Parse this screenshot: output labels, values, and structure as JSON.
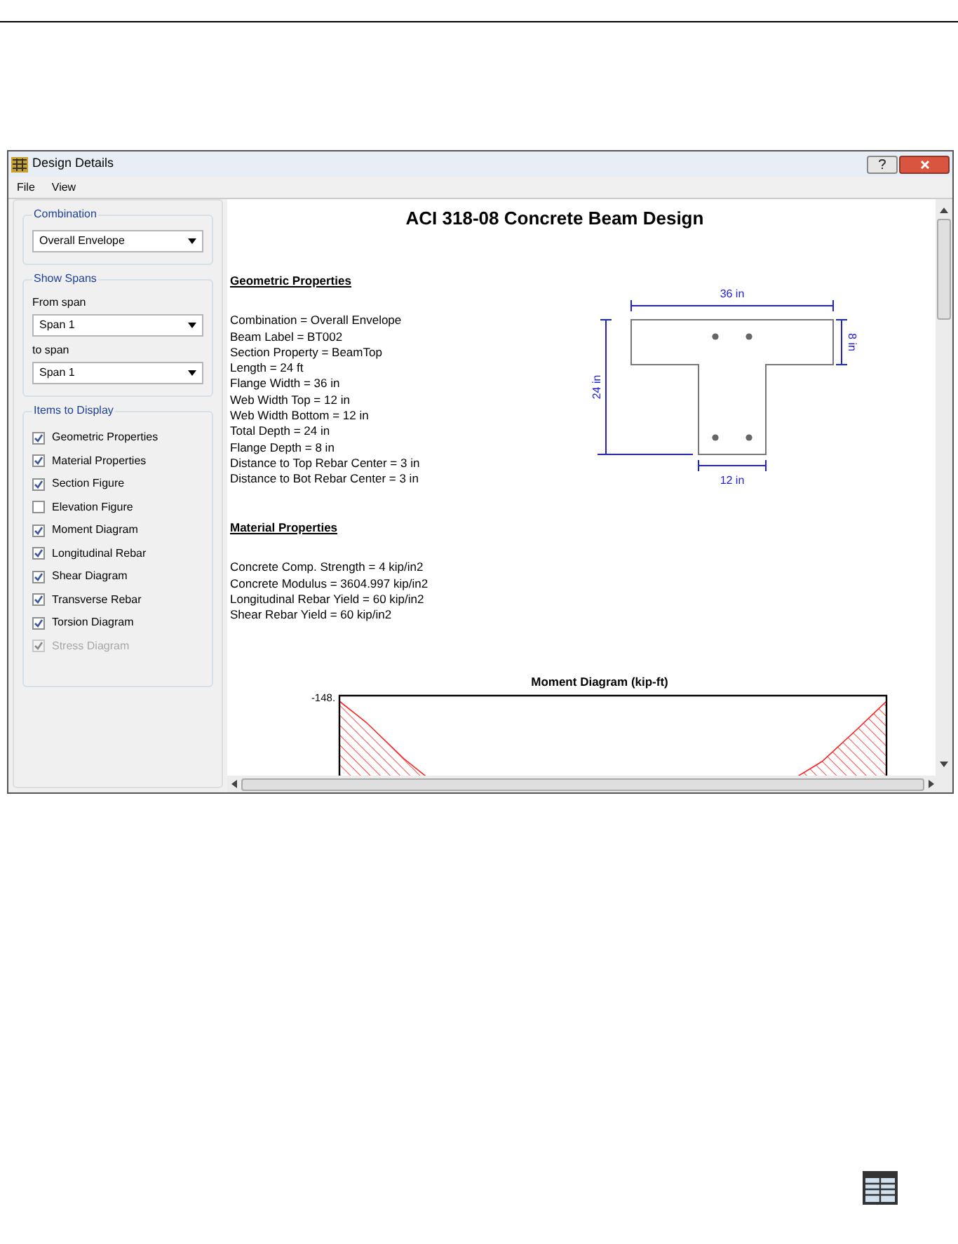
{
  "window": {
    "title": "Design Details"
  },
  "menu": [
    "File",
    "View"
  ],
  "combination": {
    "label": "Combination",
    "value": "Overall Envelope"
  },
  "show_spans": {
    "label": "Show Spans",
    "from_label": "From span",
    "from_value": "Span 1",
    "to_label": "to span",
    "to_value": "Span 1"
  },
  "items_to_display": {
    "label": "Items to Display",
    "items": [
      {
        "label": "Geometric Properties",
        "checked": true,
        "disabled": false
      },
      {
        "label": "Material Properties",
        "checked": true,
        "disabled": false
      },
      {
        "label": "Section Figure",
        "checked": true,
        "disabled": false
      },
      {
        "label": "Elevation Figure",
        "checked": false,
        "disabled": false
      },
      {
        "label": "Moment Diagram",
        "checked": true,
        "disabled": false
      },
      {
        "label": "Longitudinal Rebar",
        "checked": true,
        "disabled": false
      },
      {
        "label": "Shear Diagram",
        "checked": true,
        "disabled": false
      },
      {
        "label": "Transverse Rebar",
        "checked": true,
        "disabled": false
      },
      {
        "label": "Torsion Diagram",
        "checked": true,
        "disabled": false
      },
      {
        "label": "Stress Diagram",
        "checked": true,
        "disabled": true
      }
    ]
  },
  "report": {
    "title": "ACI 318-08 Concrete Beam Design",
    "sections": [
      {
        "heading": "Geometric Properties",
        "lines": [
          "Combination = Overall Envelope",
          "Beam Label = BT002",
          "Section Property = BeamTop",
          "Length = 24 ft",
          "Flange Width = 36 in",
          "Web Width Top = 12 in",
          "Web Width Bottom = 12 in",
          "Total Depth = 24 in",
          "Flange Depth = 8 in",
          "Distance to Top Rebar Center = 3 in",
          "Distance to Bot Rebar Center = 3 in"
        ]
      },
      {
        "heading": "Material Properties",
        "lines": [
          "Concrete Comp. Strength = 4 kip/in2",
          "Concrete Modulus = 3604.997 kip/in2",
          "Longitudinal Rebar Yield = 60 kip/in2",
          "Shear Rebar Yield = 60 kip/in2"
        ]
      }
    ],
    "section_figure": {
      "flange_width": "36 in",
      "flange_depth": "8 in",
      "total_depth": "24 in",
      "web_width": "12 in"
    },
    "moment_diagram": {
      "title": "Moment Diagram (kip-ft)",
      "top_label": "-148."
    }
  }
}
